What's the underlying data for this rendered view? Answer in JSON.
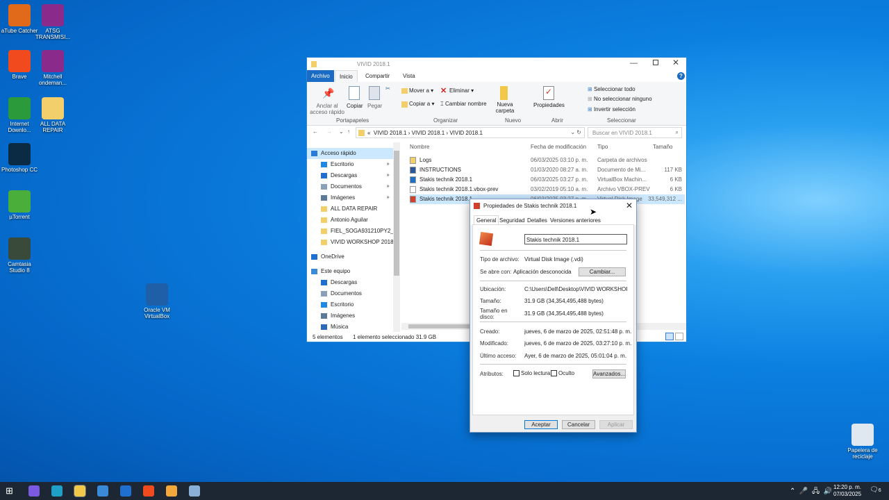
{
  "desktop": {
    "icons": [
      {
        "label": "aTube Catcher",
        "icon": "atube-icon",
        "color": "#e06a1a"
      },
      {
        "label": "ATSG TRANSMISI...",
        "icon": "winrar-icon",
        "color": "#8a2a8a"
      },
      {
        "label": "Brave",
        "icon": "brave-icon",
        "color": "#f04a1e"
      },
      {
        "label": "Mitchell ondeman...",
        "icon": "winrar-icon",
        "color": "#8a2a8a"
      },
      {
        "label": "Internet Downlo...",
        "icon": "idm-icon",
        "color": "#2a9a3a"
      },
      {
        "label": "ALL DATA REPAIR",
        "icon": "folder-icon",
        "color": "#f2cf6b"
      },
      {
        "label": "Photoshop CC",
        "icon": "photoshop-icon",
        "color": "#0b2a44"
      },
      {
        "label": "µTorrent",
        "icon": "utorrent-icon",
        "color": "#4aae3a"
      },
      {
        "label": "Camtasia Studio 8",
        "icon": "camtasia-icon",
        "color": "#3a4a3a"
      },
      {
        "label": "Oracle VM VirtualBox",
        "icon": "virtualbox-icon",
        "color": "#1e5fa8"
      },
      {
        "label": "Papelera de reciclaje",
        "icon": "recycle-bin-icon",
        "color": "#dfe8f0"
      }
    ]
  },
  "explorer": {
    "title": "VIVID 2018.1",
    "tabs": [
      "Archivo",
      "Inicio",
      "Compartir",
      "Vista"
    ],
    "ribbon": {
      "pin": "Anclar al acceso rápido",
      "copy": "Copiar",
      "paste": "Pegar",
      "move": "Mover a",
      "copyto": "Copiar a",
      "delete": "Eliminar",
      "rename": "Cambiar nombre",
      "newfolder": "Nueva carpeta",
      "properties": "Propiedades",
      "selectall": "Seleccionar todo",
      "selectnone": "No seleccionar ninguno",
      "invert": "Invertir selección",
      "groups": [
        "Portapapeles",
        "Organizar",
        "Nuevo",
        "Abrir",
        "Seleccionar"
      ]
    },
    "breadcrumb": [
      "«",
      "VIVID 2018.1",
      "VIVID 2018.1",
      "VIVID 2018.1"
    ],
    "search_placeholder": "Buscar en VIVID 2018.1",
    "nav": [
      {
        "label": "Acceso rápido",
        "icon": "star-icon",
        "color": "#2a7ad8",
        "indent": 0
      },
      {
        "label": "Escritorio",
        "icon": "desktop-icon",
        "color": "#1e88e5",
        "indent": 1,
        "pinned": true
      },
      {
        "label": "Descargas",
        "icon": "download-icon",
        "color": "#1e6fd0",
        "indent": 1,
        "pinned": true
      },
      {
        "label": "Documentos",
        "icon": "documents-icon",
        "color": "#8aa0b8",
        "indent": 1,
        "pinned": true
      },
      {
        "label": "Imágenes",
        "icon": "pictures-icon",
        "color": "#5a7a9a",
        "indent": 1,
        "pinned": true
      },
      {
        "label": "ALL DATA REPAIR",
        "icon": "folder-icon",
        "color": "#f2cf6b",
        "indent": 1
      },
      {
        "label": "Antonio Aguilar",
        "icon": "folder-icon",
        "color": "#f2cf6b",
        "indent": 1
      },
      {
        "label": "FIEL_SOGA931210PY2_20...",
        "icon": "folder-icon",
        "color": "#f2cf6b",
        "indent": 1
      },
      {
        "label": "VIVID WORKSHOP 2018.1",
        "icon": "folder-icon",
        "color": "#f2cf6b",
        "indent": 1
      },
      {
        "label": "OneDrive",
        "icon": "onedrive-icon",
        "color": "#1e6fd0",
        "indent": 0
      },
      {
        "label": "Este equipo",
        "icon": "computer-icon",
        "color": "#3a8ad8",
        "indent": 0
      },
      {
        "label": "Descargas",
        "icon": "download-icon",
        "color": "#1e6fd0",
        "indent": 1
      },
      {
        "label": "Documentos",
        "icon": "documents-icon",
        "color": "#8aa0b8",
        "indent": 1
      },
      {
        "label": "Escritorio",
        "icon": "desktop-icon",
        "color": "#1e88e5",
        "indent": 1
      },
      {
        "label": "Imágenes",
        "icon": "pictures-icon",
        "color": "#5a7a9a",
        "indent": 1
      },
      {
        "label": "Música",
        "icon": "music-icon",
        "color": "#2a6ab8",
        "indent": 1
      }
    ],
    "columns": [
      "Nombre",
      "Fecha de modificación",
      "Tipo",
      "Tamaño"
    ],
    "files": [
      {
        "name": "Logs",
        "date": "06/03/2025 03:10 p. m.",
        "type": "Carpeta de archivos",
        "size": "",
        "icon": "folder-icon",
        "color": "#f2cf6b"
      },
      {
        "name": "INSTRUCTIONS",
        "date": "01/03/2020 08:27 a. m.",
        "type": "Documento de Mi...",
        "size": "117 KB",
        "icon": "word-doc-icon",
        "color": "#2b579a"
      },
      {
        "name": "Stakis technik 2018.1",
        "date": "06/03/2025 03:27 p. m.",
        "type": "VirtualBox Machin...",
        "size": "6 KB",
        "icon": "virtualbox-icon",
        "color": "#1e6fc8"
      },
      {
        "name": "Stakis technik 2018.1.vbox-prev",
        "date": "03/02/2019 05:10 a. m.",
        "type": "Archivo VBOX-PREV",
        "size": "6 KB",
        "icon": "file-icon",
        "color": "#ffffff"
      },
      {
        "name": "Stakis technik 2018.1",
        "date": "06/03/2025 03:27 p. m.",
        "type": "Virtual Disk Image",
        "size": "33,549,312 ...",
        "icon": "vdi-icon",
        "color": "#d0402a",
        "selected": true
      }
    ],
    "status": {
      "count": "5 elementos",
      "selection": "1 elemento seleccionado  31.9 GB"
    }
  },
  "dialog": {
    "title": "Propiedades de Stakis technik 2018.1",
    "tabs": [
      "General",
      "Seguridad",
      "Detalles",
      "Versiones anteriores"
    ],
    "name": "Stakis technik 2018.1",
    "fields": {
      "type_label": "Tipo de archivo:",
      "type": "Virtual Disk Image (.vdi)",
      "opens_label": "Se abre con:",
      "opens": "Aplicación desconocida",
      "change": "Cambiar...",
      "location_label": "Ubicación:",
      "location": "C:\\Users\\Dell\\Desktop\\VIVID WORKSHOP 20",
      "size_label": "Tamaño:",
      "size": "31.9 GB (34,354,495,488 bytes)",
      "disk_label": "Tamaño en disco:",
      "disk": "31.9 GB (34,354,495,488 bytes)",
      "created_label": "Creado:",
      "created": "jueves, 6 de marzo de 2025, 02:51:48 p. m.",
      "modified_label": "Modificado:",
      "modified": "jueves, 6 de marzo de 2025, 03:27:10 p. m.",
      "accessed_label": "Último acceso:",
      "accessed": "Ayer, 6 de marzo de 2025, 05:01:04 p. m.",
      "attr_label": "Atributos:",
      "readonly": "Solo lectura",
      "hidden": "Oculto",
      "advanced": "Avanzados..."
    },
    "buttons": {
      "ok": "Aceptar",
      "cancel": "Cancelar",
      "apply": "Aplicar"
    }
  },
  "taskbar": {
    "time": "12:20 p. m.",
    "date": "07/03/2025",
    "notifications": "6",
    "apps": [
      {
        "icon": "windows-start-icon",
        "color": "#ffffff"
      },
      {
        "icon": "copilot-icon",
        "color": "#7a5ae0"
      },
      {
        "icon": "edge-icon",
        "color": "#1fa0c8"
      },
      {
        "icon": "file-explorer-icon",
        "color": "#f2c84b"
      },
      {
        "icon": "store-icon",
        "color": "#3a8ad8"
      },
      {
        "icon": "outlook-icon",
        "color": "#1e6fd0"
      },
      {
        "icon": "brave-icon",
        "color": "#f04a1e"
      },
      {
        "icon": "media-player-icon",
        "color": "#f2a83b"
      },
      {
        "icon": "virtualbox-icon",
        "color": "#8ab0d8"
      }
    ]
  }
}
